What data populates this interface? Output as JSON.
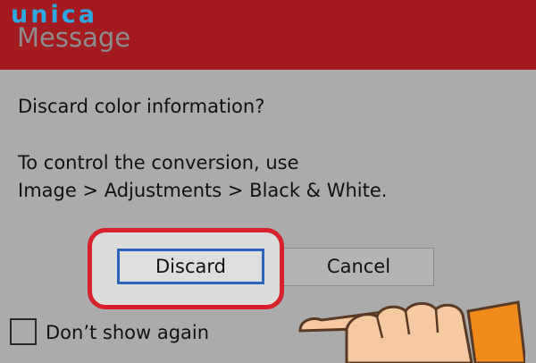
{
  "watermark": {
    "brand": "unica"
  },
  "dialog": {
    "title": "Message",
    "question": "Discard color information?",
    "instruction_line1": "To control the conversion, use",
    "instruction_line2": "Image > Adjustments > Black & White."
  },
  "buttons": {
    "discard_label": "Discard",
    "cancel_label": "Cancel"
  },
  "dont_show": {
    "label": "Don’t show again",
    "checked": false
  },
  "colors": {
    "titlebar": "#a31b1e",
    "highlight": "#d7202a",
    "focus_border": "#2b64b8",
    "logo": "#2fa7e0"
  },
  "annotation": {
    "icon": "pointing-hand-icon"
  }
}
